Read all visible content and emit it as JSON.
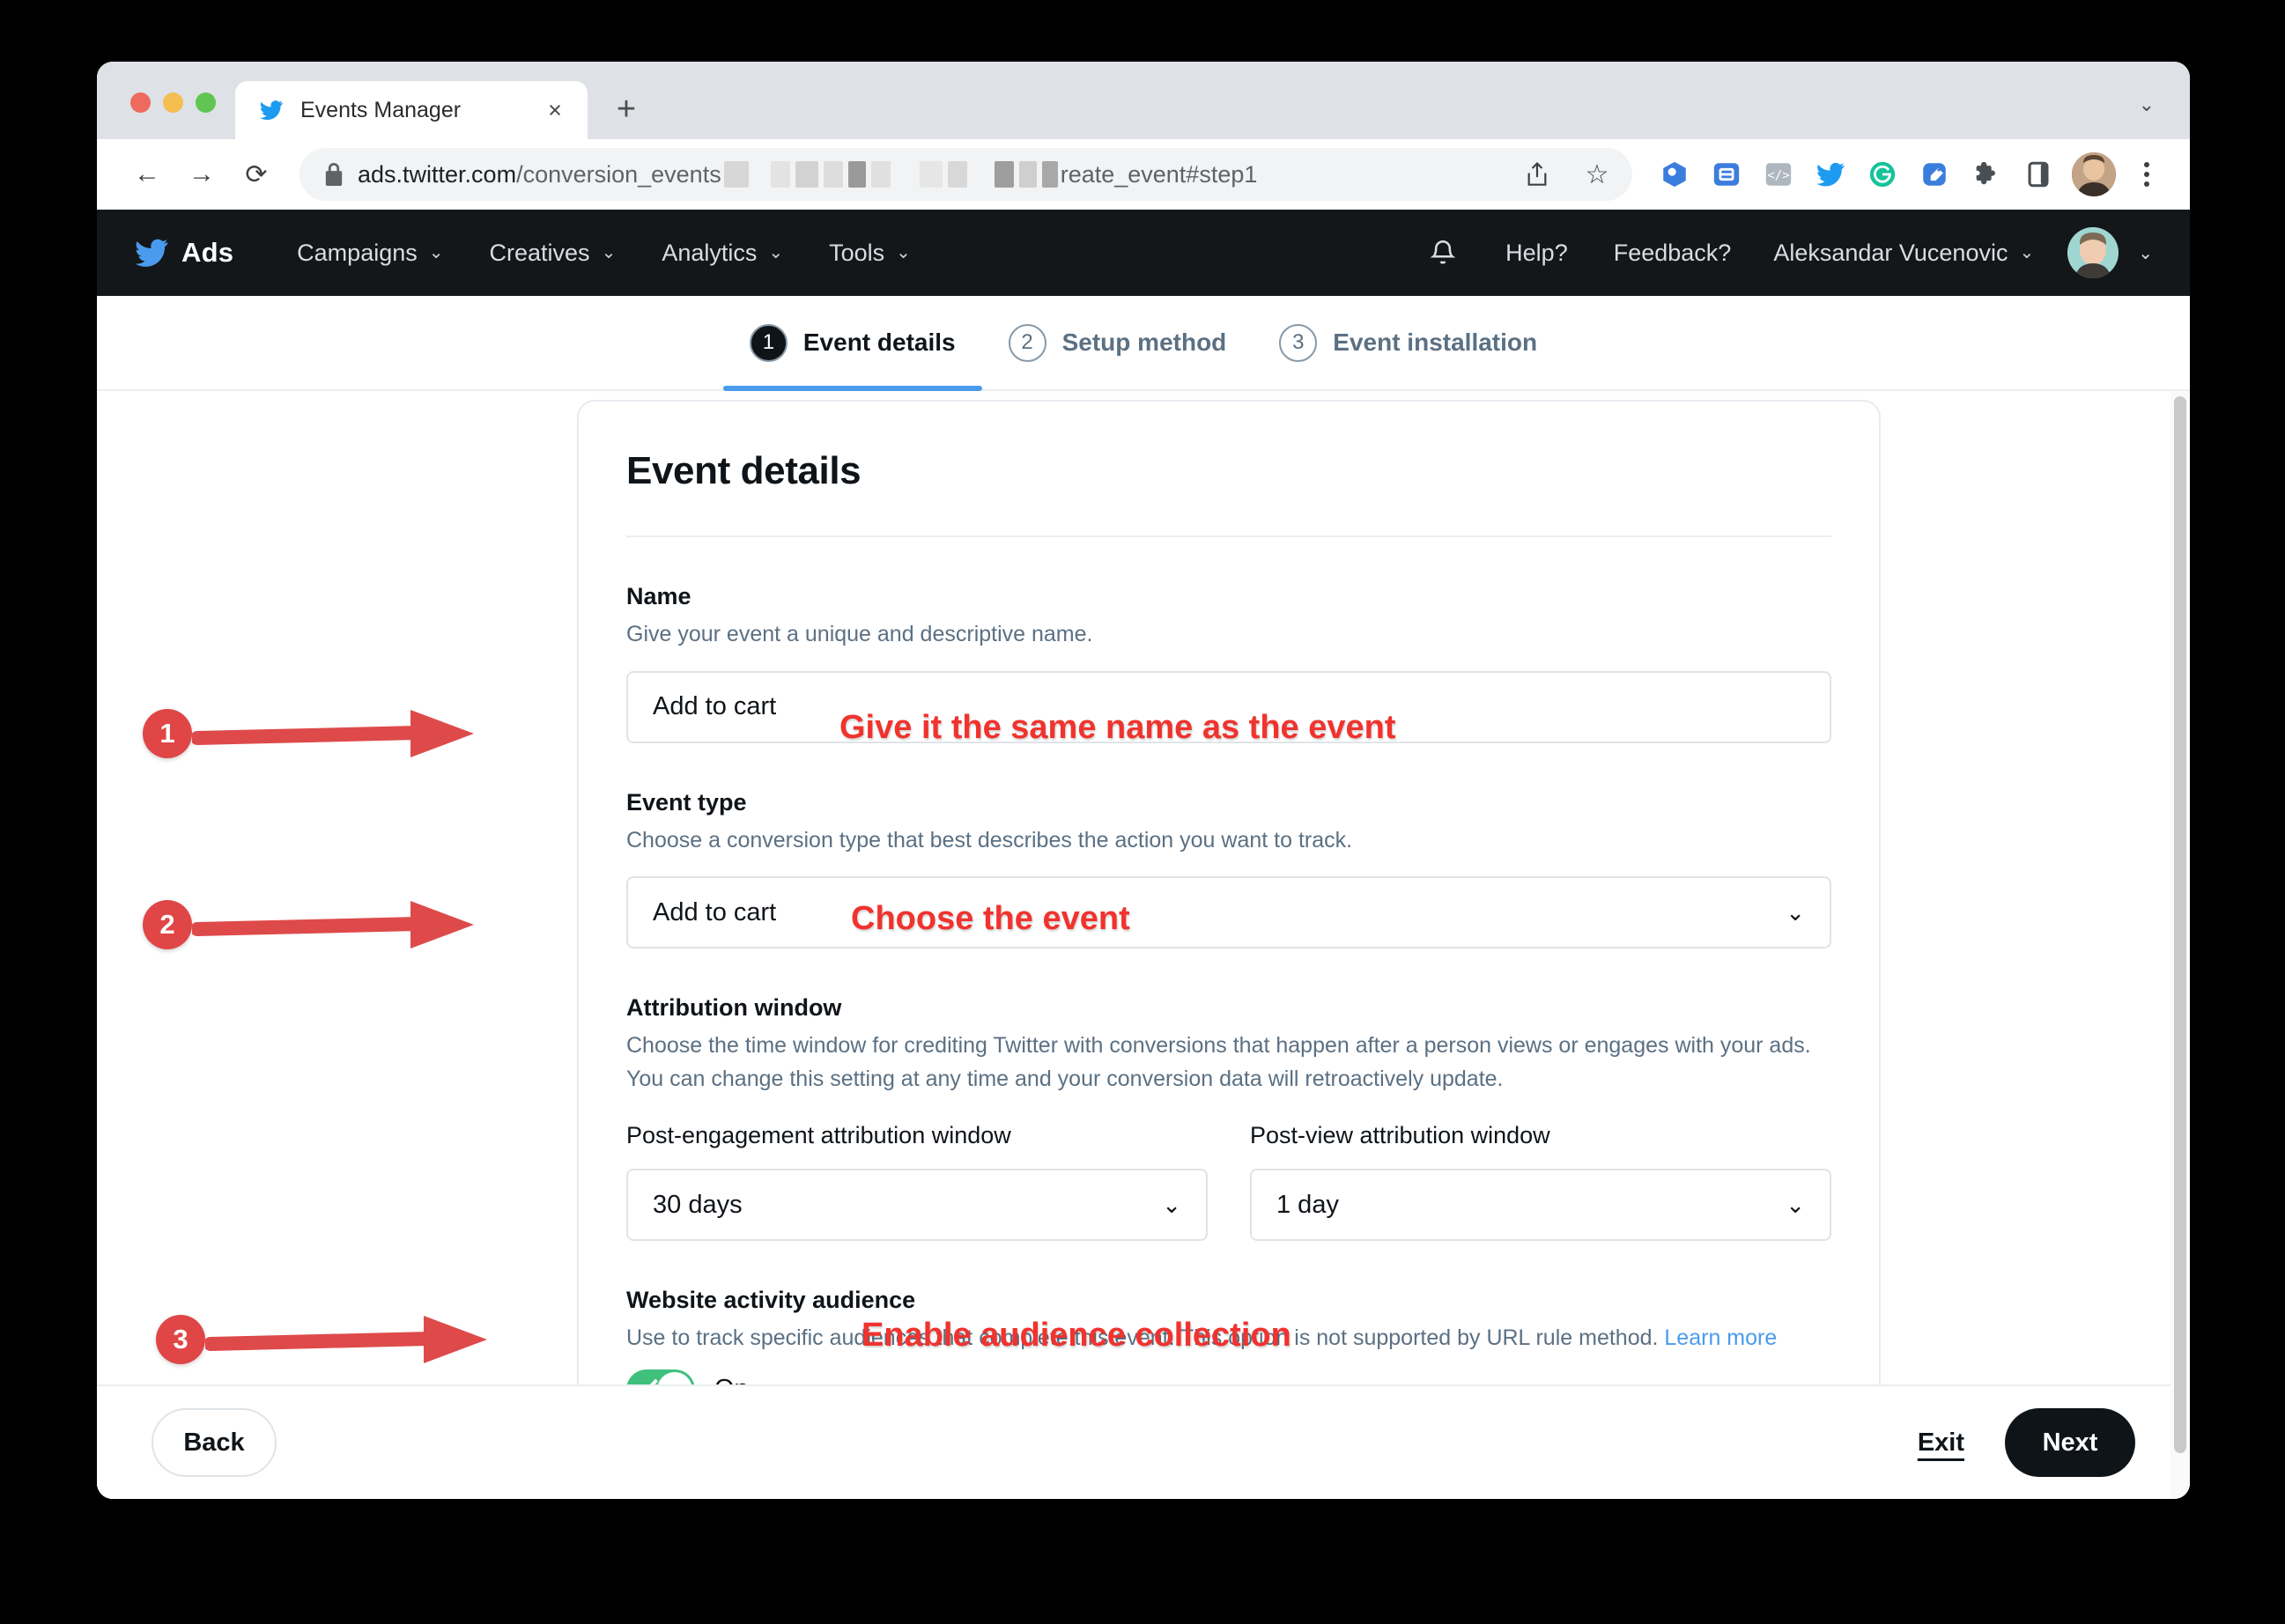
{
  "browser": {
    "tab": {
      "title": "Events Manager",
      "favicon": "twitter-bird-icon",
      "close": "×"
    },
    "new_tab": "+",
    "tabstrip_chevron": "⌄",
    "nav": {
      "back": "←",
      "forward": "→",
      "reload": "⟳"
    },
    "omnibox": {
      "lock": "lock-icon",
      "url_strong": "ads.twitter.com",
      "url_path_1": "/conversion_events",
      "url_path_2": "reate_event#step1",
      "share": "share-icon",
      "bookmark": "☆"
    },
    "extensions": [
      "google-tag-assistant-icon",
      "tag-manager-icon",
      "code-inspector-icon",
      "twitter-icon",
      "grammarly-icon",
      "tag-badge-icon",
      "puzzle-extensions-icon",
      "sidepanel-icon"
    ],
    "profile": "profile-avatar",
    "menu": "kebab-menu-icon"
  },
  "ads_nav": {
    "brand": "Ads",
    "menu": [
      {
        "label": "Campaigns",
        "chevron": "⌄"
      },
      {
        "label": "Creatives",
        "chevron": "⌄"
      },
      {
        "label": "Analytics",
        "chevron": "⌄"
      },
      {
        "label": "Tools",
        "chevron": "⌄"
      }
    ],
    "bell": "notifications-bell-icon",
    "help": "Help?",
    "feedback": "Feedback?",
    "user": "Aleksandar Vucenovic",
    "user_chevron": "⌄",
    "avatar_chevron": "⌄"
  },
  "steps": [
    {
      "num": "1",
      "label": "Event details",
      "active": true
    },
    {
      "num": "2",
      "label": "Setup method",
      "active": false
    },
    {
      "num": "3",
      "label": "Event installation",
      "active": false
    }
  ],
  "card": {
    "title": "Event details",
    "name": {
      "label": "Name",
      "help": "Give your event a unique and descriptive name.",
      "value": "Add to cart"
    },
    "event_type": {
      "label": "Event type",
      "help": "Choose a conversion type that best describes the action you want to track.",
      "value": "Add to cart",
      "chevron": "⌄"
    },
    "attribution": {
      "label": "Attribution window",
      "help": "Choose the time window for crediting Twitter with conversions that happen after a person views or engages with your ads. You can change this setting at any time and your conversion data will retroactively update.",
      "post_engagement_label": "Post-engagement attribution window",
      "post_engagement_value": "30 days",
      "post_view_label": "Post-view attribution window",
      "post_view_value": "1 day",
      "chevron": "⌄"
    },
    "audience": {
      "label": "Website activity audience",
      "help": "Use to track specific audiences that complete this event. This option is not supported by URL rule method.",
      "link": "Learn more",
      "toggle_state": "On"
    }
  },
  "footer": {
    "back": "Back",
    "exit": "Exit",
    "next": "Next"
  },
  "annotations": {
    "badge1": "1",
    "badge2": "2",
    "badge3": "3",
    "text1": "Give it the same name as the event",
    "text2": "Choose the event",
    "text3": "Enable audience collection",
    "accent_color": "#e04646",
    "text_color": "#f0332e"
  }
}
